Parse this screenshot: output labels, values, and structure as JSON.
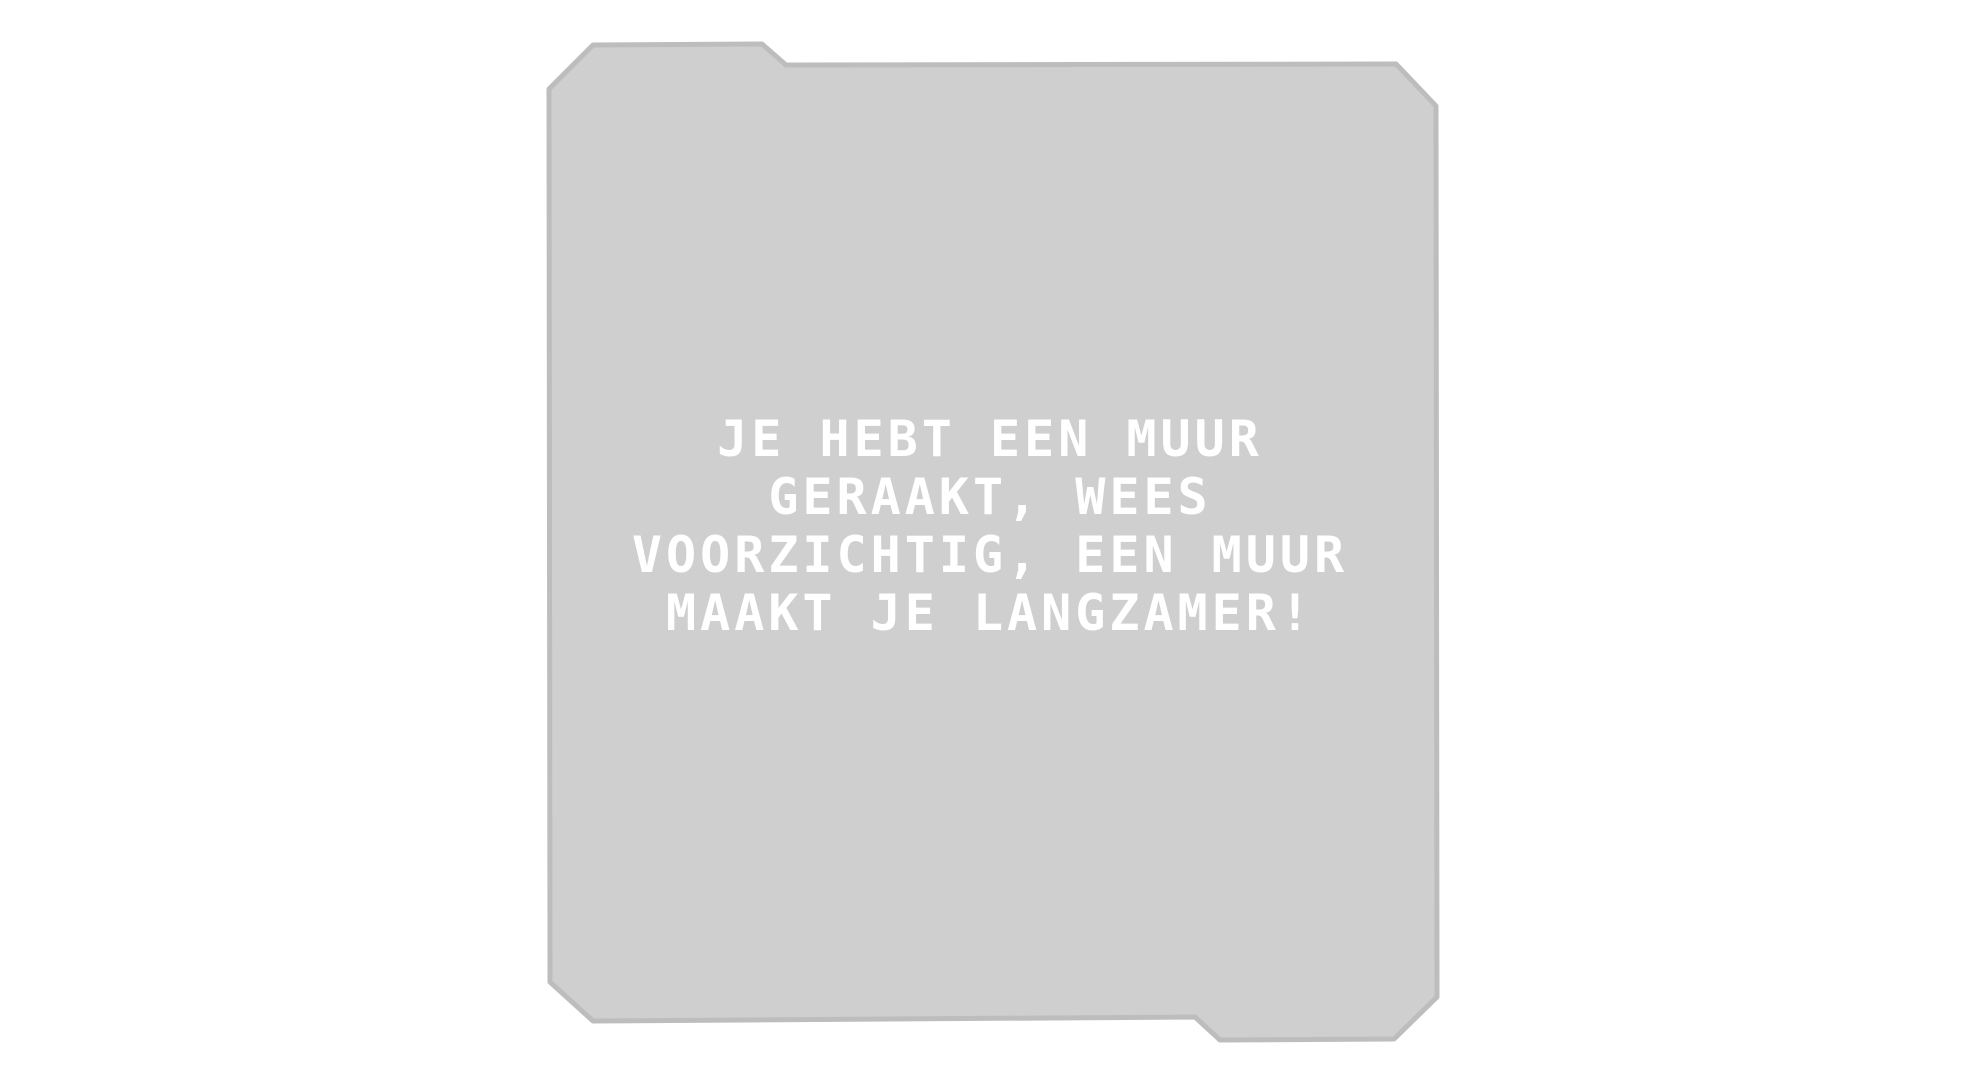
{
  "popup": {
    "lines": [
      "JE HEBT EEN MUUR",
      "GERAAKT, WEES",
      "VOORZICHTIG, EEN MUUR",
      "MAAKT JE LANGZAMER!"
    ]
  },
  "colors": {
    "background": "#ffffff",
    "panel_fill": "#cfcfcf",
    "panel_border": "#bdbdbd",
    "text": "#ffffff"
  }
}
